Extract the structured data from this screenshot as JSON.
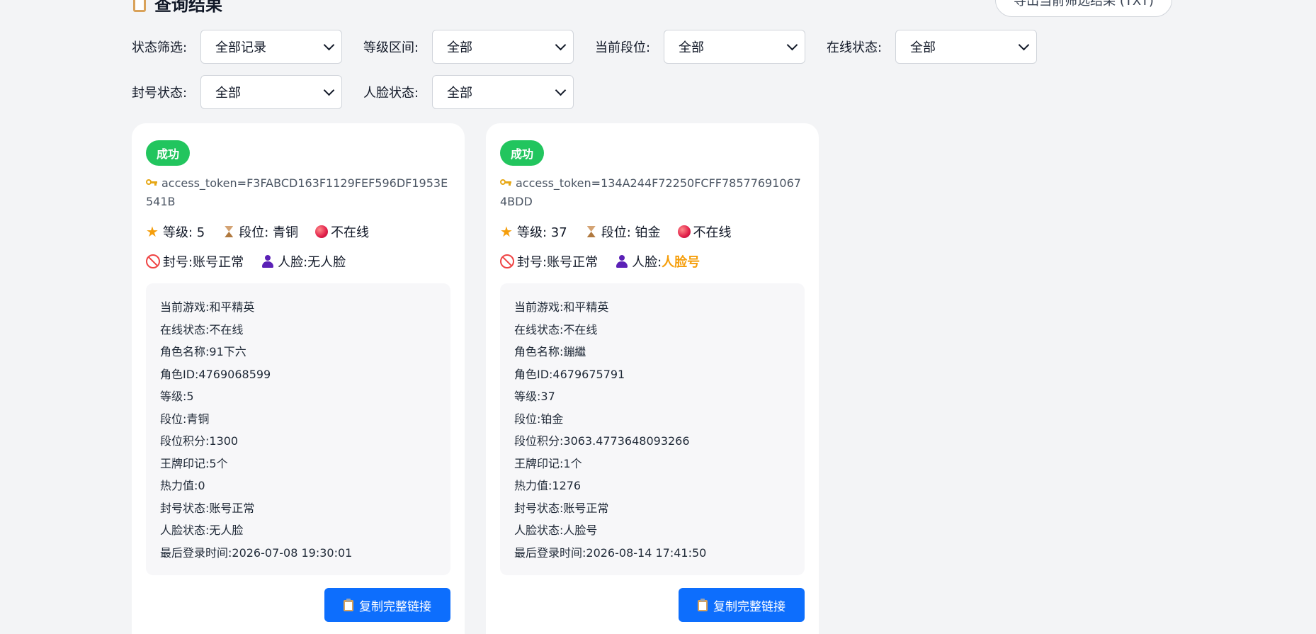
{
  "header": {
    "title": "查询结果",
    "title_icon": "clipboard-icon",
    "export_label": "导出当前筛选结果 (TXT)"
  },
  "filters": {
    "row1": [
      {
        "label": "状态筛选:",
        "value": "全部记录"
      },
      {
        "label": "等级区间:",
        "value": "全部"
      },
      {
        "label": "当前段位:",
        "value": "全部"
      },
      {
        "label": "在线状态:",
        "value": "全部"
      }
    ],
    "row2": [
      {
        "label": "封号状态:",
        "value": "全部"
      },
      {
        "label": "人脸状态:",
        "value": "全部"
      }
    ]
  },
  "cards": [
    {
      "badge": "成功",
      "token": "access_token=F3FABCD163F1129FEF596DF1953E541B",
      "level": "等级: 5",
      "rank": "段位: 青铜",
      "online": "不在线",
      "ban": "封号:账号正常",
      "face_prefix": "人脸:",
      "face_value": "无人脸",
      "face_highlight": false,
      "details": [
        "当前游戏:和平精英",
        "在线状态:不在线",
        "角色名称:91下六",
        "角色ID:4769068599",
        "等级:5",
        "段位:青铜",
        "段位积分:1300",
        "王牌印记:5个",
        "热力值:0",
        "封号状态:账号正常",
        "人脸状态:无人脸",
        "最后登录时间:2026-07-08 19:30:01"
      ],
      "copy_label": "复制完整链接"
    },
    {
      "badge": "成功",
      "token": "access_token=134A244F72250FCFF785776910674BDD",
      "level": "等级: 37",
      "rank": "段位: 铂金",
      "online": "不在线",
      "ban": "封号:账号正常",
      "face_prefix": "人脸:",
      "face_value": "人脸号",
      "face_highlight": true,
      "details": [
        "当前游戏:和平精英",
        "在线状态:不在线",
        "角色名称:鏰繼",
        "角色ID:4679675791",
        "等级:37",
        "段位:铂金",
        "段位积分:3063.4773648093266",
        "王牌印记:1个",
        "热力值:1276",
        "封号状态:账号正常",
        "人脸状态:人脸号",
        "最后登录时间:2026-08-14 17:41:50"
      ],
      "copy_label": "复制完整链接"
    }
  ],
  "colors": {
    "success": "#22c55e",
    "primary_button": "#0d6efd",
    "face_warning": "#f59e0b",
    "background": "#f3f4f6"
  }
}
